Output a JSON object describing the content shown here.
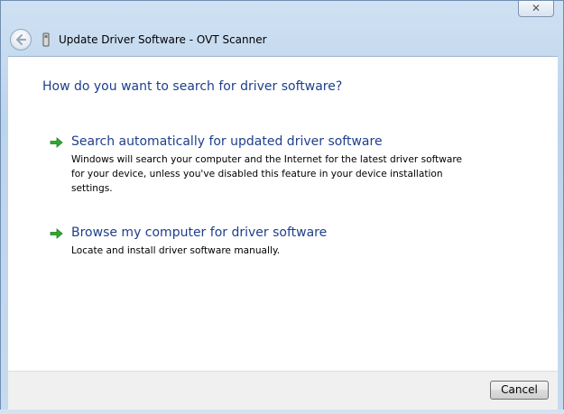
{
  "window": {
    "title": "Update Driver Software - OVT Scanner",
    "close_glyph": "✕"
  },
  "icons": {
    "back": "back-arrow-icon",
    "device": "device-icon",
    "option_arrow": "green-arrow-icon"
  },
  "colors": {
    "heading": "#1e3f8c",
    "arrow_green": "#2eaa2e",
    "content_bg": "#ffffff",
    "footer_bg": "#f0f0f0"
  },
  "main": {
    "heading": "How do you want to search for driver software?",
    "options": [
      {
        "title": "Search automatically for updated driver software",
        "description": "Windows will search your computer and the Internet for the latest driver software for your device, unless you've disabled this feature in your device installation settings."
      },
      {
        "title": "Browse my computer for driver software",
        "description": "Locate and install driver software manually."
      }
    ]
  },
  "footer": {
    "cancel_label": "Cancel"
  }
}
